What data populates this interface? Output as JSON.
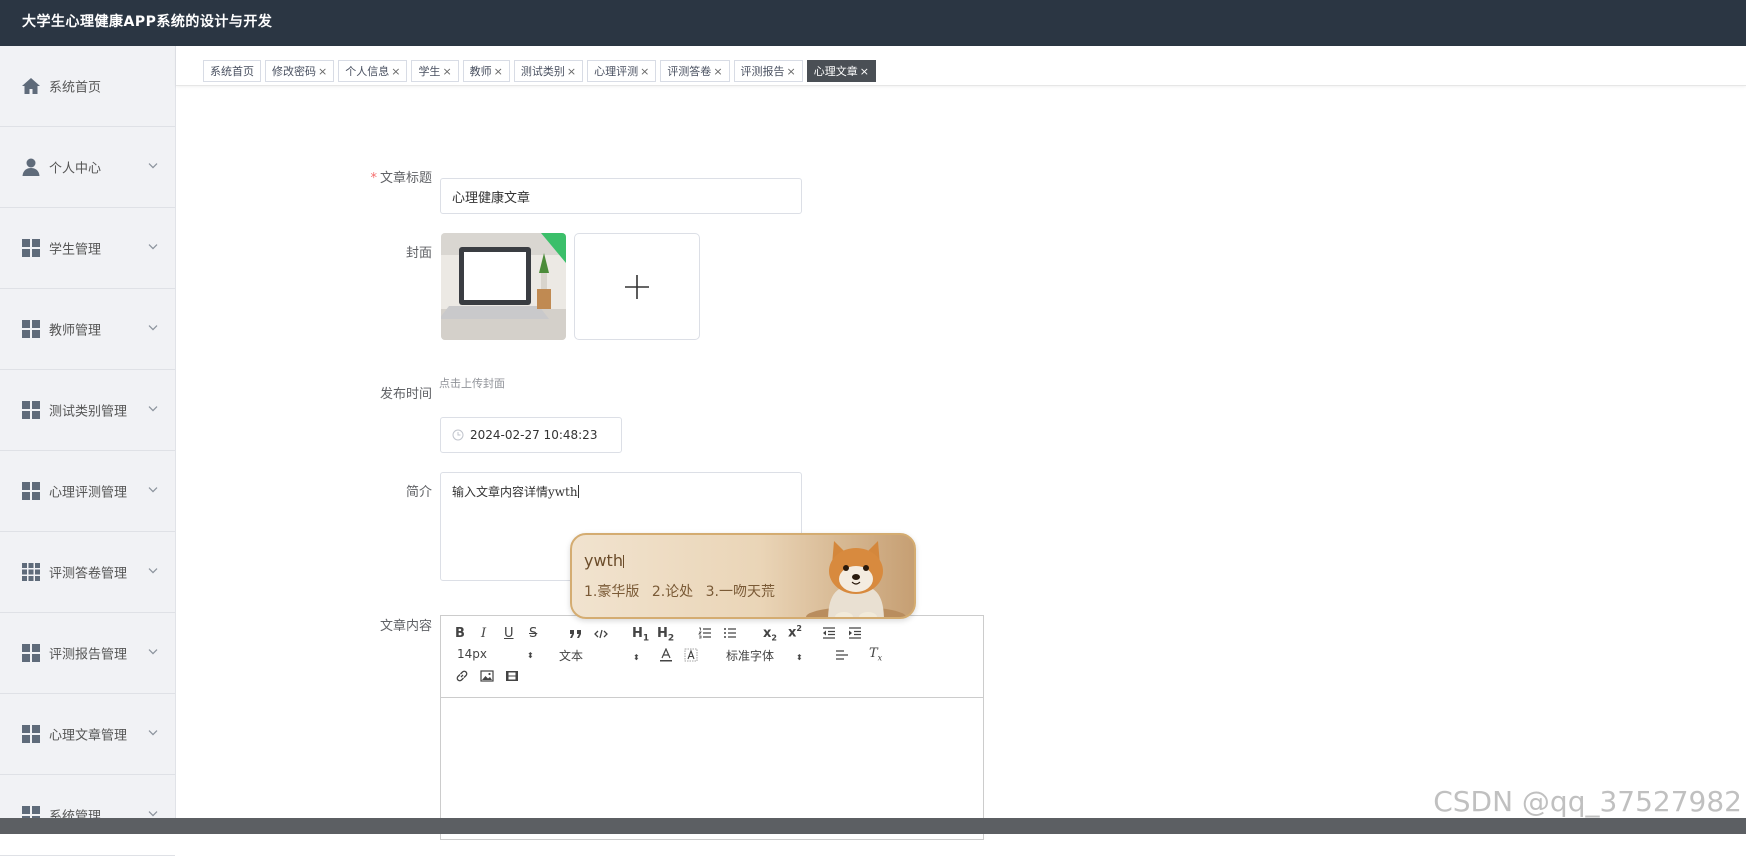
{
  "app": {
    "title": "大学生心理健康APP系统的设计与开发"
  },
  "sidebar": {
    "items": [
      {
        "label": "系统首页",
        "icon": "home-icon",
        "has_children": false
      },
      {
        "label": "个人中心",
        "icon": "user-icon",
        "has_children": true
      },
      {
        "label": "学生管理",
        "icon": "grid-icon",
        "has_children": true
      },
      {
        "label": "教师管理",
        "icon": "grid-icon",
        "has_children": true
      },
      {
        "label": "测试类别管理",
        "icon": "grid-icon",
        "has_children": true
      },
      {
        "label": "心理评测管理",
        "icon": "grid-icon",
        "has_children": true
      },
      {
        "label": "评测答卷管理",
        "icon": "grid9-icon",
        "has_children": true
      },
      {
        "label": "评测报告管理",
        "icon": "grid-icon",
        "has_children": true
      },
      {
        "label": "心理文章管理",
        "icon": "grid-icon",
        "has_children": true
      },
      {
        "label": "系统管理",
        "icon": "grid-icon",
        "has_children": true
      }
    ]
  },
  "tabs": [
    {
      "label": "系统首页",
      "closable": false,
      "active": false
    },
    {
      "label": "修改密码",
      "closable": true,
      "active": false
    },
    {
      "label": "个人信息",
      "closable": true,
      "active": false
    },
    {
      "label": "学生",
      "closable": true,
      "active": false
    },
    {
      "label": "教师",
      "closable": true,
      "active": false
    },
    {
      "label": "测试类别",
      "closable": true,
      "active": false
    },
    {
      "label": "心理评测",
      "closable": true,
      "active": false
    },
    {
      "label": "评测答卷",
      "closable": true,
      "active": false
    },
    {
      "label": "评测报告",
      "closable": true,
      "active": false
    },
    {
      "label": "心理文章",
      "closable": true,
      "active": true
    }
  ],
  "tab_close_glyph": "×",
  "form": {
    "title_label": "文章标题",
    "required_mark": "*",
    "title_value": "心理健康文章",
    "cover_label": "封面",
    "cover_hint": "点击上传封面",
    "publish_label": "发布时间",
    "publish_value": "2024-02-27 10:48:23",
    "intro_label": "简介",
    "intro_value": "输入文章内容详情ywth",
    "content_label": "文章内容"
  },
  "ime": {
    "composition": "ywth",
    "candidates": [
      "1.豪华版",
      "2.论处",
      "3.一吻天荒"
    ]
  },
  "editor": {
    "size_value": "14px",
    "header_value": "文本",
    "font_value": "标准字体"
  },
  "watermark": "CSDN @qq_37527982",
  "colors": {
    "topbar": "#2b3643",
    "sidebar_icon": "#5f6b7a",
    "active_tab": "#4a4f55",
    "required": "#f56c6c"
  }
}
